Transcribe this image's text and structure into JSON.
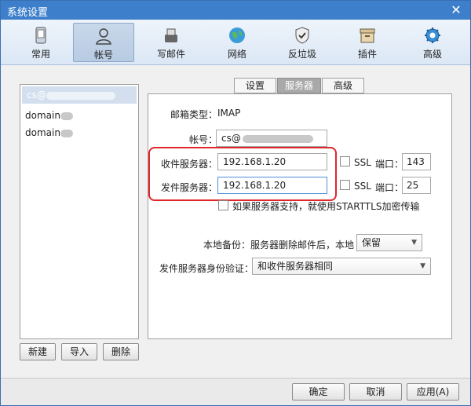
{
  "window": {
    "title": "系统设置"
  },
  "toolbar": {
    "items": [
      {
        "label": "常用",
        "icon": "phone-icon"
      },
      {
        "label": "帐号",
        "icon": "user-icon"
      },
      {
        "label": "写邮件",
        "icon": "compose-icon"
      },
      {
        "label": "网络",
        "icon": "globe-icon"
      },
      {
        "label": "反垃圾",
        "icon": "shield-icon"
      },
      {
        "label": "插件",
        "icon": "plugin-icon"
      },
      {
        "label": "高级",
        "icon": "gear-icon"
      }
    ],
    "active_index": 1
  },
  "accounts": {
    "items": [
      {
        "label": "cs@",
        "selected": true
      },
      {
        "label": "domain",
        "selected": false
      },
      {
        "label": "domain",
        "selected": false
      }
    ],
    "new_label": "新建",
    "import_label": "导入",
    "delete_label": "删除"
  },
  "tabs": [
    {
      "label": "设置",
      "active": false
    },
    {
      "label": "服务器",
      "active": true
    },
    {
      "label": "高级",
      "active": false
    }
  ],
  "server": {
    "mailbox_type_label": "邮箱类型：",
    "mailbox_type_value": "IMAP",
    "account_label": "帐号：",
    "account_value": "cs@",
    "incoming_label": "收件服务器：",
    "incoming_value": "192.168.1.20",
    "outgoing_label": "发件服务器：",
    "outgoing_value": "192.168.1.20",
    "ssl_label": "SSL",
    "port_label": "端口：",
    "incoming_port": "143",
    "outgoing_port": "25",
    "starttls_label": "如果服务器支持，就使用STARTTLS加密传输",
    "backup_label": "本地备份：",
    "backup_desc": "服务器删除邮件后，本地",
    "backup_value": "保留",
    "auth_label": "发件服务器身份验证：",
    "auth_value": "和收件服务器相同"
  },
  "footer": {
    "ok_label": "确定",
    "cancel_label": "取消",
    "apply_label": "应用(A)"
  },
  "colors": {
    "titlebar": "#3d7fcb",
    "highlight": "#e0262b"
  }
}
